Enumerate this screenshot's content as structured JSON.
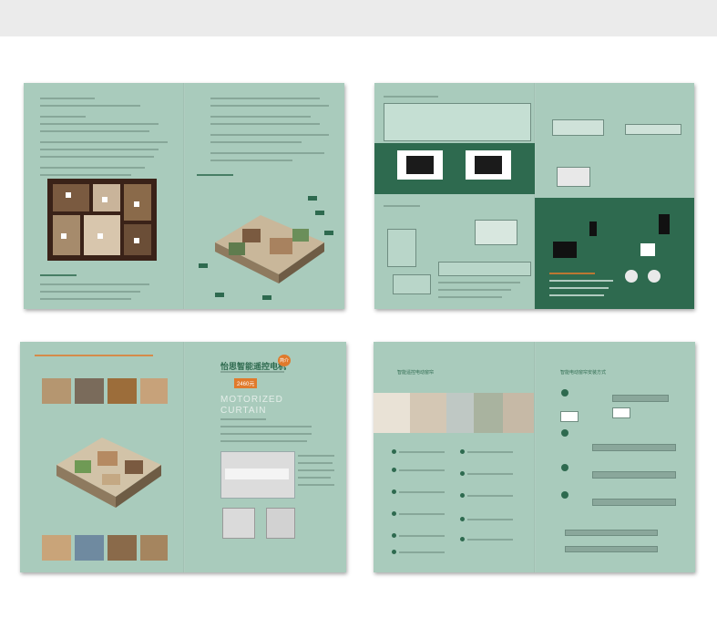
{
  "brochure": {
    "spread3": {
      "headline": "怡思智能遥控电机",
      "badge": "简介",
      "price": "2460元",
      "product_title_line1": "MOTORIZED",
      "product_title_line2": "CURTAIN"
    },
    "spread4": {
      "section_title_left": "智能遥控电动窗帘",
      "section_title_right": "智能电动窗帘安装方式"
    }
  },
  "colors": {
    "page_bg": "#a9cbbc",
    "dark_green": "#2e6a4f",
    "accent_orange": "#e07a2c"
  }
}
